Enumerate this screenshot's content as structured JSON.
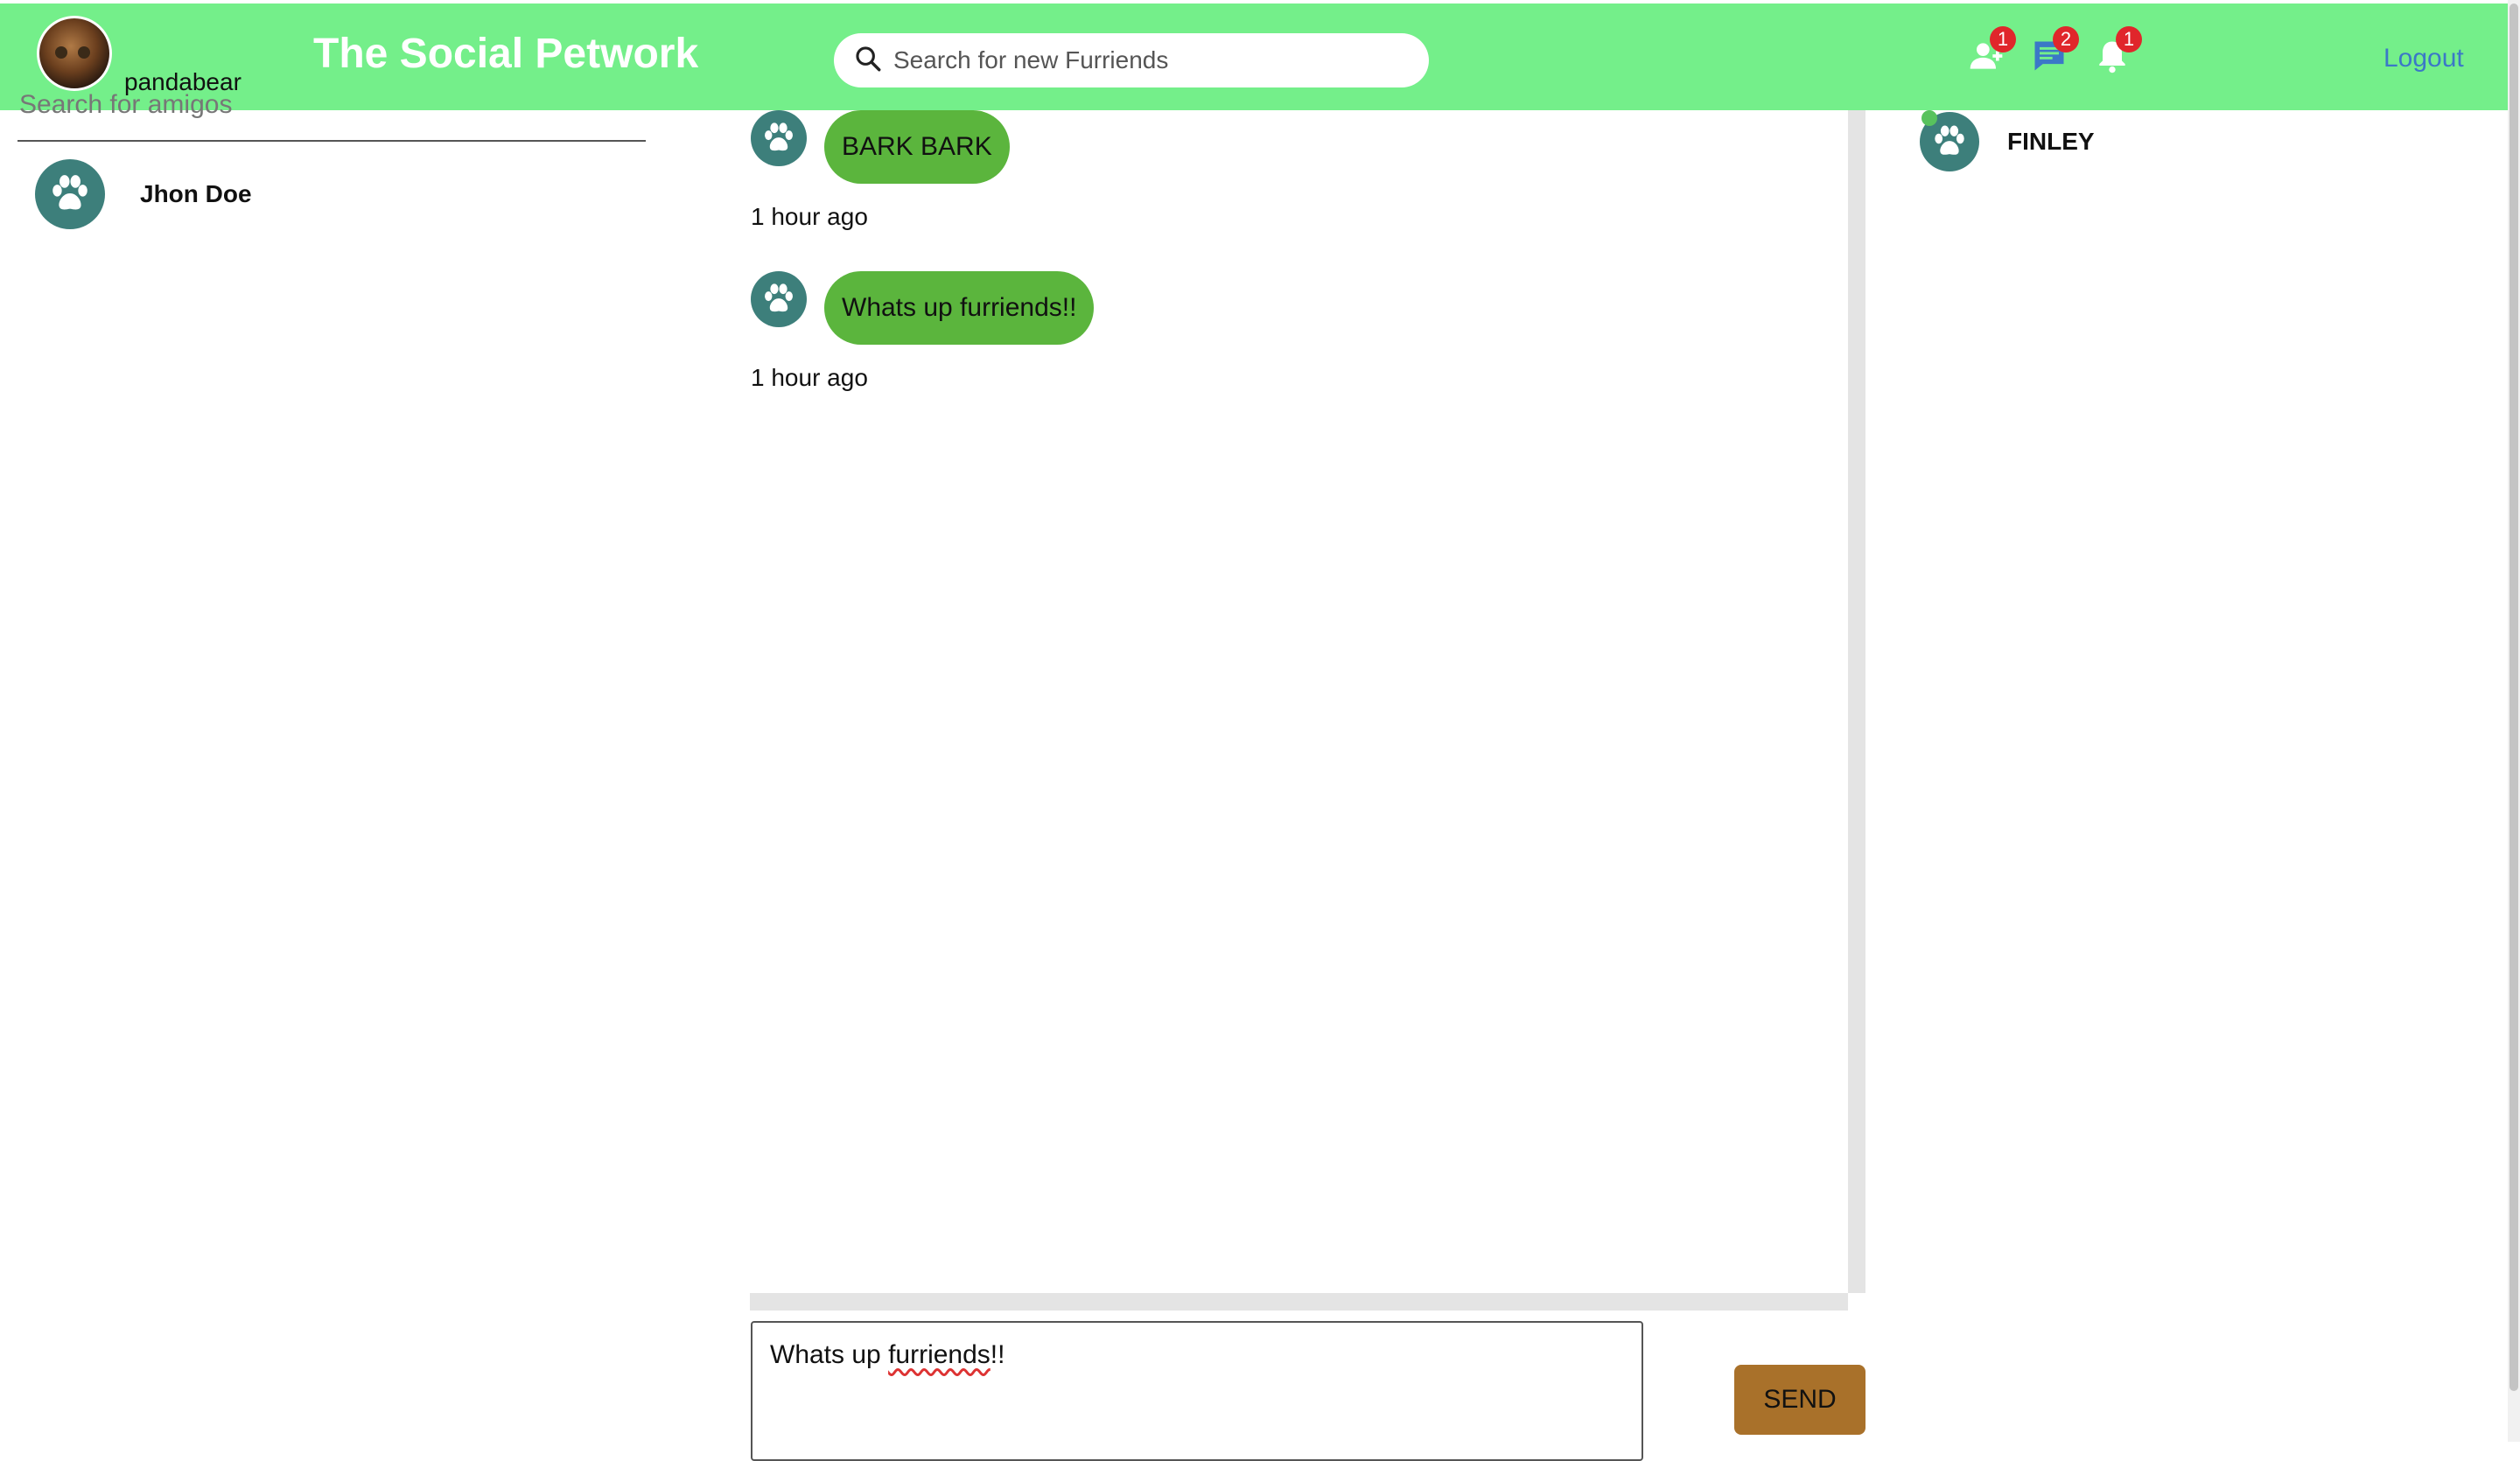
{
  "header": {
    "username": "pandabear",
    "brand": "The Social Petwork",
    "search_placeholder": "Search for new Furriends",
    "friend_requests_count": "1",
    "messages_count": "2",
    "notifications_count": "1",
    "logout_label": "Logout"
  },
  "sidebar": {
    "search_placeholder": "Search for amigos",
    "contacts": [
      {
        "name": "Jhon Doe"
      }
    ]
  },
  "chat": {
    "messages": [
      {
        "text": "BARK BARK",
        "time": "1 hour ago"
      },
      {
        "text": "Whats up furriends!!",
        "time": "1 hour ago"
      }
    ],
    "compose_prefix": "Whats up ",
    "compose_misspelled": "furriends",
    "compose_suffix": "!!",
    "send_label": "SEND"
  },
  "online": {
    "users": [
      {
        "name": "FINLEY"
      }
    ]
  },
  "colors": {
    "header_bg": "#74ef8a",
    "bubble_bg": "#5bb53d",
    "paw_bg": "#3d7f7b",
    "send_bg": "#a9712a",
    "badge_bg": "#e0262b",
    "logout": "#3b78c7"
  },
  "icons": {
    "header": [
      "search-icon",
      "friend-request-icon",
      "message-icon",
      "notification-bell-icon"
    ],
    "avatars": "paw-icon"
  }
}
